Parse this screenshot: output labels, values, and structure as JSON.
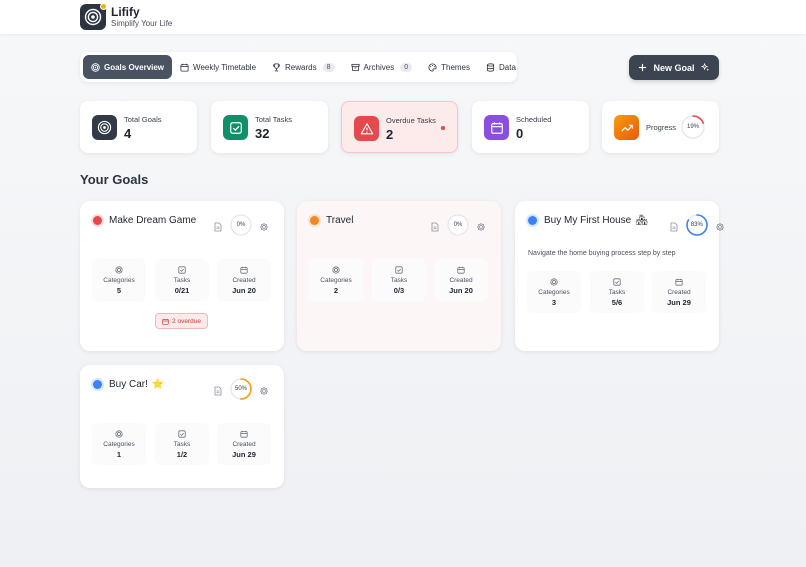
{
  "app": {
    "name": "Lifify",
    "tagline": "Simplify Your Life"
  },
  "nav": {
    "tabs": [
      {
        "label": "Goals Overview",
        "icon": "target-icon",
        "active": true
      },
      {
        "label": "Weekly Timetable",
        "icon": "calendar-icon"
      },
      {
        "label": "Rewards",
        "icon": "trophy-icon",
        "badge": "8"
      },
      {
        "label": "Archives",
        "icon": "archive-icon",
        "badge": "0"
      },
      {
        "label": "Themes",
        "icon": "palette-icon"
      },
      {
        "label": "Data",
        "icon": "database-icon"
      }
    ],
    "new_goal_label": "New Goal"
  },
  "stats": {
    "total_goals": {
      "label": "Total Goals",
      "value": "4"
    },
    "total_tasks": {
      "label": "Total Tasks",
      "value": "32"
    },
    "overdue_tasks": {
      "label": "Overdue Tasks",
      "value": "2"
    },
    "scheduled": {
      "label": "Scheduled",
      "value": "0"
    },
    "progress": {
      "label": "Progress",
      "percent_text": "19%",
      "percent": 19
    }
  },
  "section_title": "Your Goals",
  "labels": {
    "categories": "Categories",
    "tasks": "Tasks",
    "created": "Created"
  },
  "goals": [
    {
      "title": "Make Dream Game",
      "emoji": "",
      "color": "#e5484d",
      "progress_text": "0%",
      "progress": 0,
      "categories": "5",
      "tasks": "0/21",
      "created": "Jun 20",
      "overdue_text": "2 overdue",
      "description": ""
    },
    {
      "title": "Travel",
      "emoji": "",
      "color": "#f08a24",
      "progress_text": "0%",
      "progress": 0,
      "categories": "2",
      "tasks": "0/3",
      "created": "Jun 20",
      "description": ""
    },
    {
      "title": "Buy My First House",
      "emoji": "🏘",
      "color": "#3b82f6",
      "progress_text": "83%",
      "progress": 83,
      "categories": "3",
      "tasks": "5/6",
      "created": "Jun 29",
      "description": "Navigate the home buying process step by step"
    },
    {
      "title": "Buy Car!",
      "emoji": "⭐",
      "color": "#3b82f6",
      "progress_text": "50%",
      "progress": 50,
      "categories": "1",
      "tasks": "1/2",
      "created": "Jun 29",
      "description": ""
    }
  ],
  "colors": {
    "ring_red": "#e5484d",
    "ring_blue": "#3b82f6",
    "ring_orange": "#f59e0b",
    "goals_icon_bg": "#323a48",
    "tasks_icon_bg": "#10906a",
    "overdue_icon_bg": "#e5484d",
    "scheduled_icon_bg": "#8b4fe0",
    "progress_icon_bg": "#f07318"
  }
}
